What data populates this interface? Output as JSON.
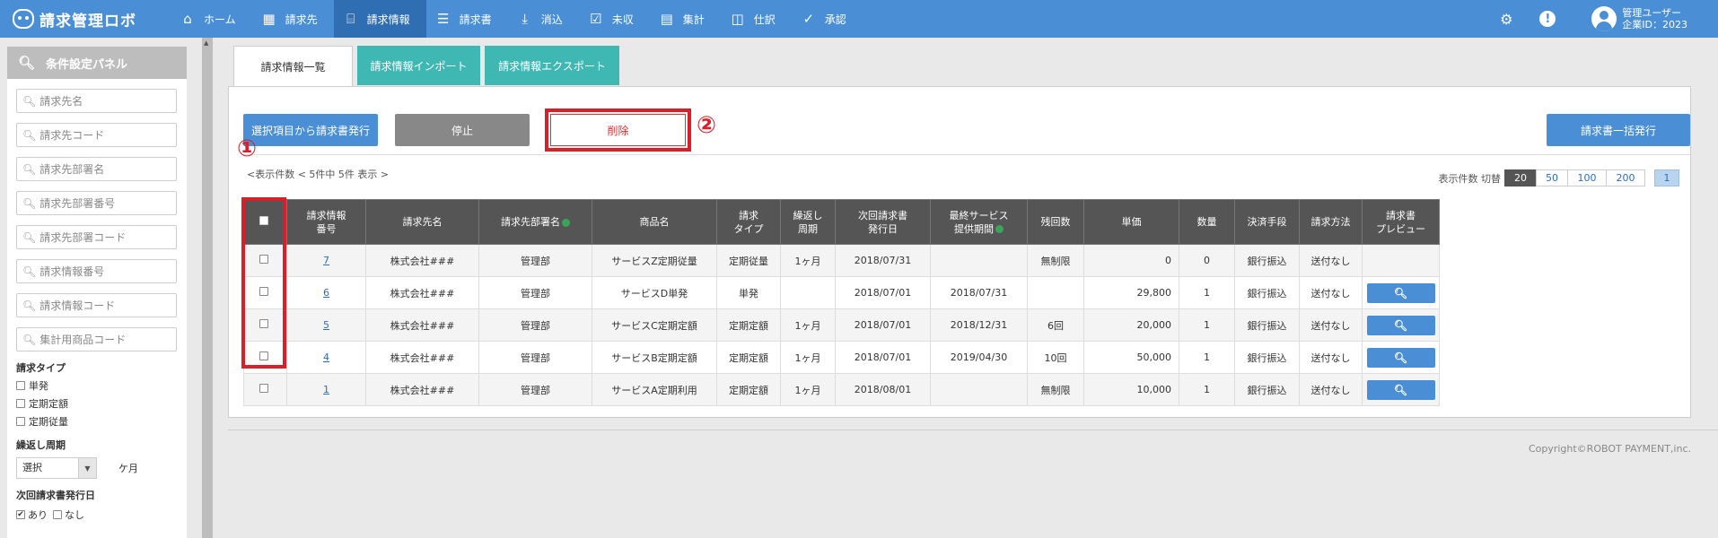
{
  "app": {
    "title": "請求管理ロボ"
  },
  "nav": {
    "items": [
      {
        "label": "ホーム",
        "icon": "home-icon",
        "glyph": "⌂"
      },
      {
        "label": "請求先",
        "icon": "building-icon",
        "glyph": "▦"
      },
      {
        "label": "請求情報",
        "icon": "inbox-icon",
        "glyph": "⌸"
      },
      {
        "label": "請求書",
        "icon": "document-list-icon",
        "glyph": "☰"
      },
      {
        "label": "消込",
        "icon": "download-icon",
        "glyph": "⤓"
      },
      {
        "label": "未収",
        "icon": "checkbox-icon",
        "glyph": "☑"
      },
      {
        "label": "集計",
        "icon": "calculator-icon",
        "glyph": "▤"
      },
      {
        "label": "仕訳",
        "icon": "book-icon",
        "glyph": "◫"
      },
      {
        "label": "承認",
        "icon": "check-circle-icon",
        "glyph": "✓"
      }
    ],
    "active_index": 2
  },
  "user": {
    "name": "管理ユーザー",
    "company": "企業ID：2023"
  },
  "side_panel": {
    "title": "条件設定パネル",
    "inputs": [
      "請求先名",
      "請求先コード",
      "請求先部署名",
      "請求先部署番号",
      "請求先部署コード",
      "請求情報番号",
      "請求情報コード",
      "集計用商品コード"
    ],
    "billing_type_label": "請求タイプ",
    "billing_types": [
      "単発",
      "定期定額",
      "定期従量"
    ],
    "cycle_label": "繰返し周期",
    "cycle_select": "選択",
    "cycle_unit": "ケ月",
    "next_date_label": "次回請求書発行日",
    "next_date_options": [
      {
        "label": "あり",
        "checked": true
      },
      {
        "label": "なし",
        "checked": false
      }
    ]
  },
  "tabs": [
    "請求情報一覧",
    "請求情報インポート",
    "請求情報エクスポート"
  ],
  "toolbar": {
    "issue_selected": "選択項目から請求書発行",
    "stop": "停止",
    "delete": "削除",
    "bulk_issue": "請求書一括発行"
  },
  "annotations": {
    "one": "①",
    "two": "②"
  },
  "summary": "<表示件数 < 5件中 5件 表示 >",
  "per_page": {
    "label": "表示件数 切替",
    "options": [
      "20",
      "50",
      "100",
      "200"
    ],
    "selected": "20",
    "page": "1"
  },
  "table": {
    "headers": [
      "",
      "請求情報\n番号",
      "請求先名",
      "請求先部署名",
      "商品名",
      "請求\nタイプ",
      "繰返し\n周期",
      "次回請求書\n発行日",
      "最終サービス\n提供期間",
      "残回数",
      "単価",
      "数量",
      "決済手段",
      "請求方法",
      "請求書\nプレビュー"
    ],
    "rows": [
      {
        "id": "7",
        "customer": "株式会社###",
        "dept": "管理部",
        "product": "サービスZ定期従量",
        "type": "定期従量",
        "cycle": "1ヶ月",
        "next": "2018/07/31",
        "last": "",
        "remaining": "無制限",
        "price": "0",
        "qty": "0",
        "payment": "銀行振込",
        "method": "送付なし",
        "preview": false
      },
      {
        "id": "6",
        "customer": "株式会社###",
        "dept": "管理部",
        "product": "サービスD単発",
        "type": "単発",
        "cycle": "",
        "next": "2018/07/01",
        "last": "2018/07/31",
        "remaining": "",
        "price": "29,800",
        "qty": "1",
        "payment": "銀行振込",
        "method": "送付なし",
        "preview": true
      },
      {
        "id": "5",
        "customer": "株式会社###",
        "dept": "管理部",
        "product": "サービスC定期定額",
        "type": "定期定額",
        "cycle": "1ヶ月",
        "next": "2018/07/01",
        "last": "2018/12/31",
        "remaining": "6回",
        "price": "20,000",
        "qty": "1",
        "payment": "銀行振込",
        "method": "送付なし",
        "preview": true
      },
      {
        "id": "4",
        "customer": "株式会社###",
        "dept": "管理部",
        "product": "サービスB定期定額",
        "type": "定期定額",
        "cycle": "1ヶ月",
        "next": "2018/07/01",
        "last": "2019/04/30",
        "remaining": "10回",
        "price": "50,000",
        "qty": "1",
        "payment": "銀行振込",
        "method": "送付なし",
        "preview": true
      },
      {
        "id": "1",
        "customer": "株式会社###",
        "dept": "管理部",
        "product": "サービスA定期利用",
        "type": "定期定額",
        "cycle": "1ヶ月",
        "next": "2018/08/01",
        "last": "",
        "remaining": "無制限",
        "price": "10,000",
        "qty": "1",
        "payment": "銀行振込",
        "method": "送付なし",
        "preview": true
      }
    ]
  },
  "footer": {
    "copyright": "Copyright©ROBOT PAYMENT,inc."
  }
}
